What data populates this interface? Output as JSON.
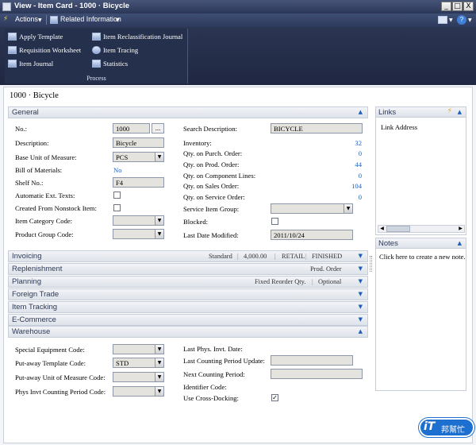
{
  "window": {
    "title": "View - Item Card - 1000 · Bicycle",
    "min_glyph": "_",
    "max_glyph": "□",
    "close_glyph": "X"
  },
  "commandbar": {
    "actions": "Actions",
    "related": "Related Information",
    "help": "?"
  },
  "ribbon": {
    "items": [
      "Apply Template",
      "Item Reclassification Journal",
      "Requisition Worksheet",
      "Item Tracing",
      "Item Journal",
      "Statistics"
    ],
    "group_title": "Process"
  },
  "header": {
    "title": "1000 · Bicycle"
  },
  "general": {
    "tab_label": "General",
    "left": {
      "no_label": "No.:",
      "no_value": "1000",
      "no_btn": "...",
      "desc_label": "Description:",
      "desc_value": "Bicycle",
      "buom_label": "Base Unit of Measure:",
      "buom_value": "PCS",
      "bom_label": "Bill of Materials:",
      "bom_value": "No",
      "shelf_label": "Shelf No.:",
      "shelf_value": "F4",
      "ext_label": "Automatic Ext. Texts:",
      "nonstock_label": "Created From Nonstock Item:",
      "itemcat_label": "Item Category Code:",
      "prodgrp_label": "Product Group Code:"
    },
    "right": {
      "search_label": "Search Description:",
      "search_value": "BICYCLE",
      "inv_label": "Inventory:",
      "inv_value": "32",
      "purch_label": "Qty. on Purch. Order:",
      "purch_value": "0",
      "prod_label": "Qty. on Prod. Order:",
      "prod_value": "44",
      "comp_label": "Qty. on Component Lines:",
      "comp_value": "0",
      "sales_label": "Qty. on Sales Order:",
      "sales_value": "104",
      "service_label": "Qty. on Service Order:",
      "service_value": "0",
      "svcgrp_label": "Service Item Group:",
      "blocked_label": "Blocked:",
      "lastmod_label": "Last Date Modified:",
      "lastmod_value": "2011/10/24"
    }
  },
  "fasttabs": {
    "invoicing": {
      "label": "Invoicing",
      "s1": "Standard",
      "s2": "4,000.00",
      "s3": "RETAIL",
      "s4": "FINISHED"
    },
    "replenishment": {
      "label": "Replenishment",
      "s1": "Prod. Order"
    },
    "planning": {
      "label": "Planning",
      "s1": "Fixed Reorder Qty.",
      "s2": "Optional"
    },
    "foreign": {
      "label": "Foreign Trade"
    },
    "tracking": {
      "label": "Item Tracking"
    },
    "ecommerce": {
      "label": "E-Commerce"
    },
    "warehouse": {
      "label": "Warehouse"
    }
  },
  "warehouse": {
    "special_label": "Special Equipment Code:",
    "putaway_tpl_label": "Put-away Template Code:",
    "putaway_tpl_value": "STD",
    "putaway_uom_label": "Put-away Unit of Measure Code:",
    "phys_label": "Phys Invt Counting Period Code:",
    "lastphys_label": "Last Phys. Invt. Date:",
    "lastcount_label": "Last Counting Period Update:",
    "nextcount_label": "Next Counting Period:",
    "identifier_label": "Identifier Code:",
    "crossdock_label": "Use Cross-Docking:"
  },
  "links": {
    "title": "Links",
    "col": "Link Address"
  },
  "notes": {
    "title": "Notes",
    "placeholder": "Click here to create a new note."
  },
  "watermark": {
    "text1": "iT",
    "text2": "邦幫忙"
  }
}
